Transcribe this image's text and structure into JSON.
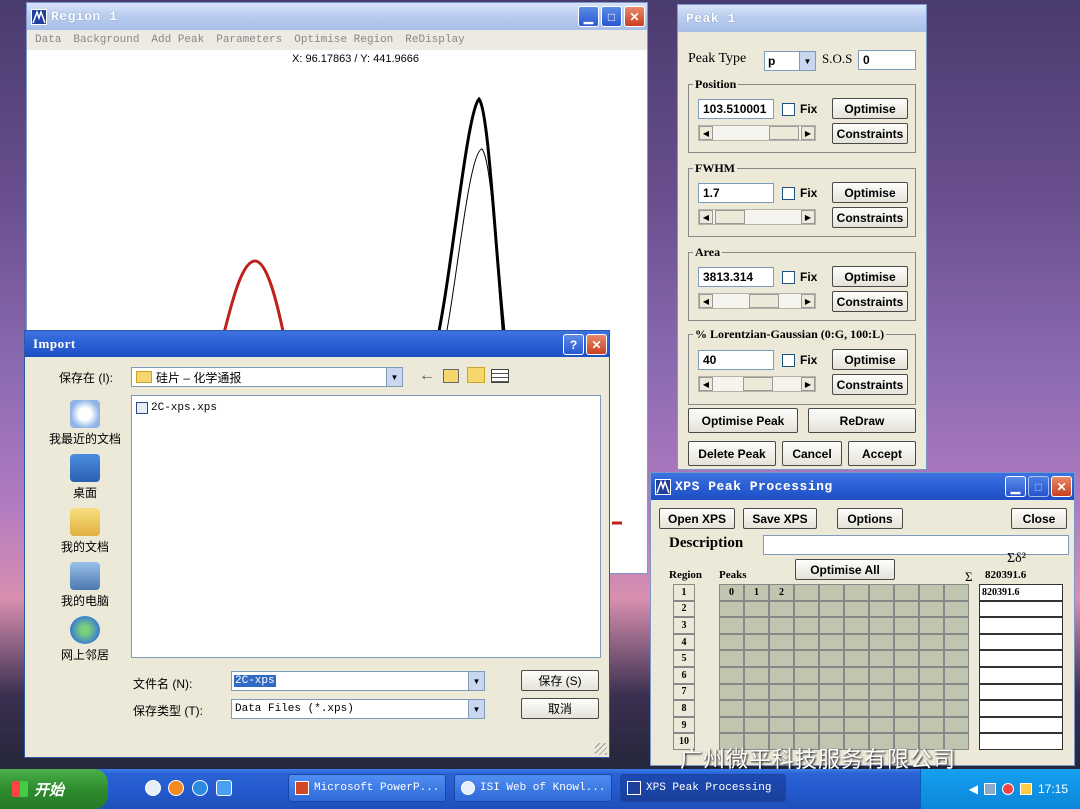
{
  "region_window": {
    "title": "Region 1",
    "menu": [
      "Data",
      "Background",
      "Add Peak",
      "Parameters",
      "Optimise Region",
      "ReDisplay"
    ],
    "coords": "X: 96.17863 / Y: 441.9666"
  },
  "peak_window": {
    "title": "Peak 1",
    "peak_type_label": "Peak Type",
    "peak_type_value": "p",
    "sos_label": "S.O.S",
    "sos_value": "0",
    "groups": [
      {
        "legend": "Position",
        "value": "103.510001",
        "fix": "Fix",
        "optimise": "Optimise",
        "constraints": "Constraints"
      },
      {
        "legend": "FWHM",
        "value": "1.7",
        "fix": "Fix",
        "optimise": "Optimise",
        "constraints": "Constraints"
      },
      {
        "legend": "Area",
        "value": "3813.314",
        "fix": "Fix",
        "optimise": "Optimise",
        "constraints": "Constraints"
      },
      {
        "legend": "% Lorentzian-Gaussian (0:G, 100:L)",
        "value": "40",
        "fix": "Fix",
        "optimise": "Optimise",
        "constraints": "Constraints"
      }
    ],
    "buttons": {
      "optimise_peak": "Optimise Peak",
      "redraw": "ReDraw",
      "delete_peak": "Delete Peak",
      "cancel": "Cancel",
      "accept": "Accept"
    }
  },
  "xps_window": {
    "title": "XPS Peak Processing",
    "toolbar": {
      "open": "Open XPS",
      "save": "Save XPS",
      "options": "Options",
      "close": "Close"
    },
    "description_label": "Description",
    "optimise_all": "Optimise All",
    "region_header": "Region",
    "peaks_header": "Peaks",
    "peak_cols": [
      "0",
      "1",
      "2"
    ],
    "regions": [
      "1",
      "2",
      "3",
      "4",
      "5",
      "6",
      "7",
      "8",
      "9",
      "10"
    ],
    "sigma_header": "Σδ²",
    "sigma_symbol": "Σ",
    "sigma_total": "820391.6",
    "sigma_rows": [
      "820391.6",
      "",
      "",
      "",
      "",
      "",
      "",
      "",
      "",
      ""
    ]
  },
  "import_dialog": {
    "title": "Import",
    "save_in_label": "保存在 (I):",
    "folder": "硅片 – 化学通报",
    "places": [
      "我最近的文档",
      "桌面",
      "我的文档",
      "我的电脑",
      "网上邻居"
    ],
    "files": [
      "2C-xps.xps"
    ],
    "filename_label": "文件名 (N):",
    "filename_value": "2C-xps",
    "filetype_label": "保存类型 (T):",
    "filetype_value": "Data Files (*.xps)",
    "save_button": "保存 (S)",
    "cancel_button": "取消"
  },
  "taskbar": {
    "start": "开始",
    "tasks": [
      "Microsoft PowerP...",
      "ISI Web of Knowl...",
      "XPS Peak Processing"
    ],
    "clock": "17:15"
  },
  "watermark": "广州微平科技服务有限公司",
  "colors": {
    "xp_blue": "#2a5fd6",
    "fit_red": "#c0201c",
    "grid_fill": "#bfc5ae"
  }
}
